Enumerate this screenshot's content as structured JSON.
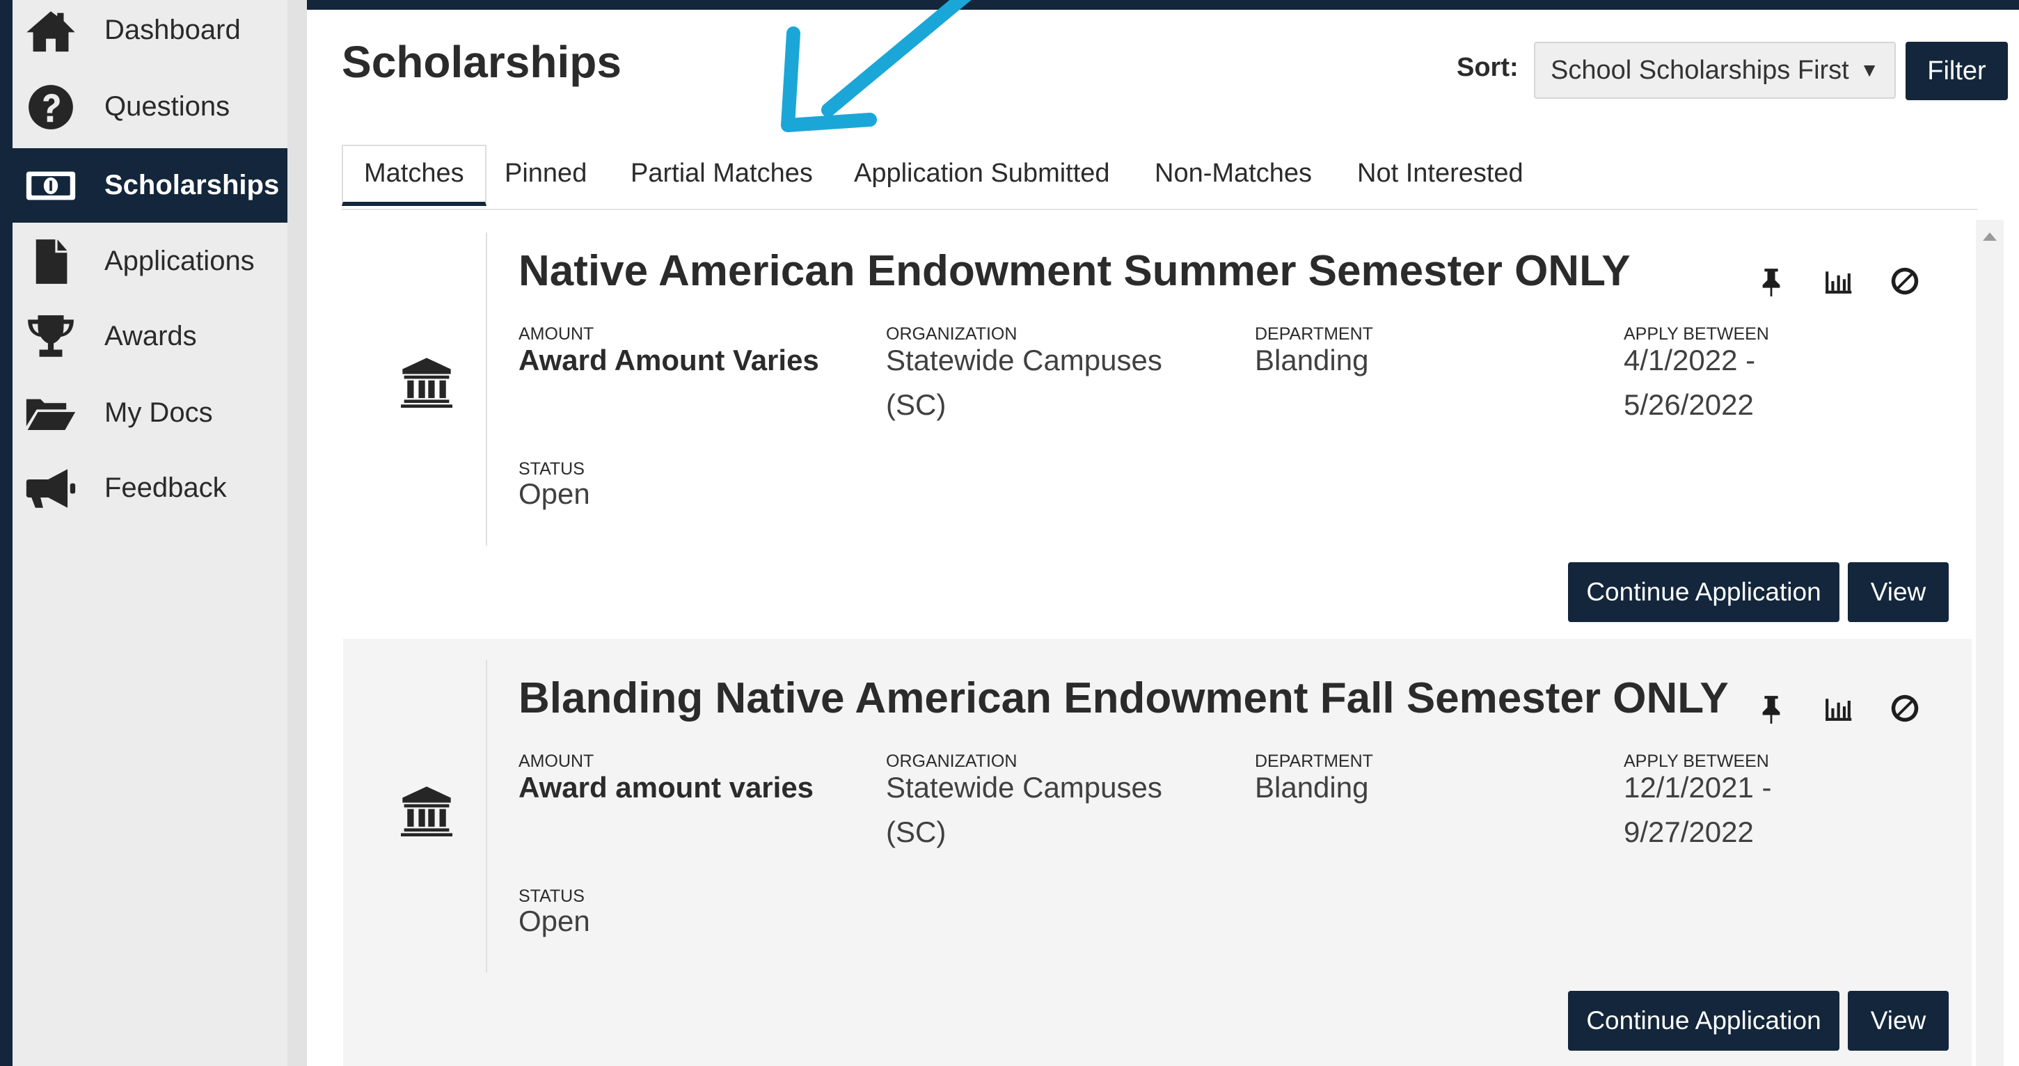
{
  "colors": {
    "navy": "#13263b",
    "arrow": "#1aa7d8"
  },
  "sidebar": {
    "items": [
      {
        "label": "Dashboard",
        "icon": "home-icon"
      },
      {
        "label": "Questions",
        "icon": "question-circle-icon"
      },
      {
        "label": "Scholarships",
        "icon": "money-icon",
        "active": true
      },
      {
        "label": "Applications",
        "icon": "file-icon"
      },
      {
        "label": "Awards",
        "icon": "trophy-icon"
      },
      {
        "label": "My Docs",
        "icon": "folder-open-icon"
      },
      {
        "label": "Feedback",
        "icon": "bullhorn-icon"
      }
    ]
  },
  "header": {
    "title": "Scholarships",
    "sort_label": "Sort:",
    "sort_value": "School Scholarships First",
    "filter_label": "Filter"
  },
  "tabs": [
    {
      "label": "Matches",
      "active": true
    },
    {
      "label": "Pinned"
    },
    {
      "label": "Partial Matches"
    },
    {
      "label": "Application Submitted"
    },
    {
      "label": "Non-Matches"
    },
    {
      "label": "Not Interested"
    }
  ],
  "cards": [
    {
      "title": "Native American Endowment Summer Semester ONLY",
      "amount_label": "AMOUNT",
      "amount_value": "Award Amount Varies",
      "org_label": "ORGANIZATION",
      "org_value": "Statewide Campuses (SC)",
      "dept_label": "DEPARTMENT",
      "dept_value": "Blanding",
      "apply_label": "APPLY BETWEEN",
      "apply_value": "4/1/2022 - 5/26/2022",
      "status_label": "STATUS",
      "status_value": "Open",
      "continue_label": "Continue Application",
      "view_label": "View"
    },
    {
      "title": "Blanding Native American Endowment Fall Semester ONLY",
      "amount_label": "AMOUNT",
      "amount_value": "Award amount varies",
      "org_label": "ORGANIZATION",
      "org_value": "Statewide Campuses (SC)",
      "dept_label": "DEPARTMENT",
      "dept_value": "Blanding",
      "apply_label": "APPLY BETWEEN",
      "apply_value": "12/1/2021 - 9/27/2022",
      "status_label": "STATUS",
      "status_value": "Open",
      "continue_label": "Continue Application",
      "view_label": "View"
    }
  ]
}
